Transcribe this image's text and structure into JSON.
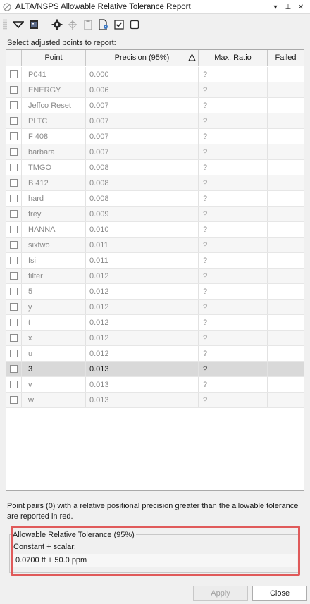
{
  "window": {
    "title": "ALTA/NSPS Allowable Relative Tolerance Report",
    "controls": {
      "dropdown": "▾",
      "pin": "⊥",
      "close": "✕"
    }
  },
  "toolbar": {
    "icons": [
      "menu-dropdown-icon",
      "report-icon",
      "settings-gear-icon",
      "target-icon",
      "clipboard-icon",
      "document-settings-icon",
      "check-all-icon",
      "uncheck-all-icon"
    ]
  },
  "prompt": "Select adjusted points to report:",
  "grid": {
    "columns": [
      "",
      "Point",
      "Precision (95%)",
      "Max. Ratio",
      "Failed"
    ],
    "rows": [
      {
        "point": "P041",
        "precision": "0.000",
        "ratio": "?",
        "failed": ""
      },
      {
        "point": "ENERGY",
        "precision": "0.006",
        "ratio": "?",
        "failed": ""
      },
      {
        "point": "Jeffco Reset",
        "precision": "0.007",
        "ratio": "?",
        "failed": ""
      },
      {
        "point": "PLTC",
        "precision": "0.007",
        "ratio": "?",
        "failed": ""
      },
      {
        "point": "F 408",
        "precision": "0.007",
        "ratio": "?",
        "failed": ""
      },
      {
        "point": "barbara",
        "precision": "0.007",
        "ratio": "?",
        "failed": ""
      },
      {
        "point": "TMGO",
        "precision": "0.008",
        "ratio": "?",
        "failed": ""
      },
      {
        "point": "B 412",
        "precision": "0.008",
        "ratio": "?",
        "failed": ""
      },
      {
        "point": "hard",
        "precision": "0.008",
        "ratio": "?",
        "failed": ""
      },
      {
        "point": "frey",
        "precision": "0.009",
        "ratio": "?",
        "failed": ""
      },
      {
        "point": "HANNA",
        "precision": "0.010",
        "ratio": "?",
        "failed": ""
      },
      {
        "point": "sixtwo",
        "precision": "0.011",
        "ratio": "?",
        "failed": ""
      },
      {
        "point": "fsi",
        "precision": "0.011",
        "ratio": "?",
        "failed": ""
      },
      {
        "point": "filter",
        "precision": "0.012",
        "ratio": "?",
        "failed": ""
      },
      {
        "point": "5",
        "precision": "0.012",
        "ratio": "?",
        "failed": ""
      },
      {
        "point": "y",
        "precision": "0.012",
        "ratio": "?",
        "failed": ""
      },
      {
        "point": "t",
        "precision": "0.012",
        "ratio": "?",
        "failed": ""
      },
      {
        "point": "x",
        "precision": "0.012",
        "ratio": "?",
        "failed": ""
      },
      {
        "point": "u",
        "precision": "0.012",
        "ratio": "?",
        "failed": ""
      },
      {
        "point": "3",
        "precision": "0.013",
        "ratio": "?",
        "failed": "",
        "selected": true
      },
      {
        "point": "v",
        "precision": "0.013",
        "ratio": "?",
        "failed": ""
      },
      {
        "point": "w",
        "precision": "0.013",
        "ratio": "?",
        "failed": ""
      }
    ]
  },
  "info_text": "Point pairs (0) with a relative positional precision greater than the allowable tolerance are reported in red.",
  "tolerance": {
    "group_label": "Allowable Relative Tolerance (95%)",
    "sub_label": "Constant + scalar:",
    "value": "0.0700 ft + 50.0 ppm"
  },
  "buttons": {
    "apply": "Apply",
    "close": "Close"
  },
  "colors": {
    "highlight": "#e05a5a",
    "selected_row": "#d9d9d9"
  }
}
